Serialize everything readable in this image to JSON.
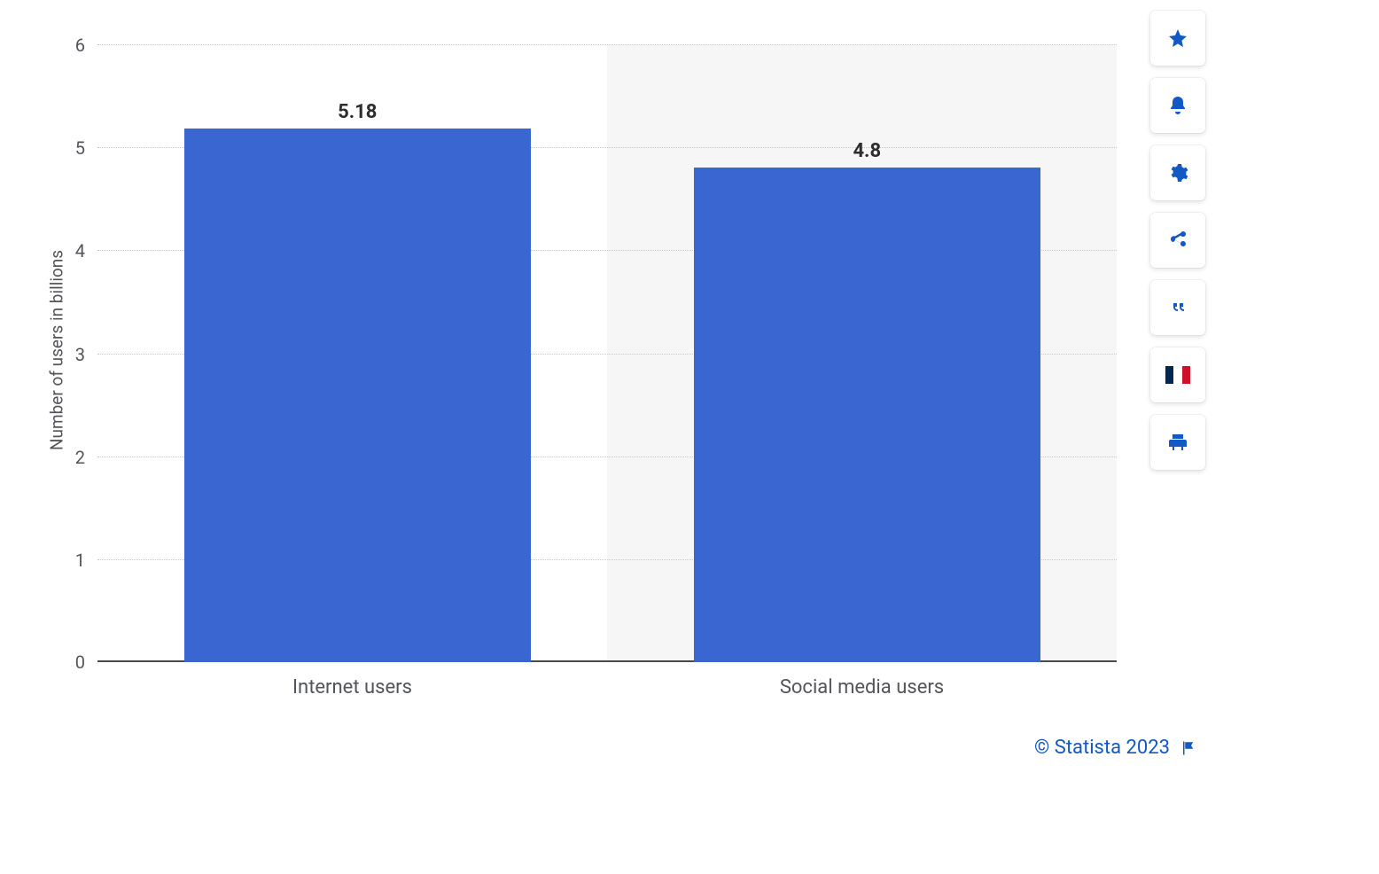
{
  "chart_data": {
    "type": "bar",
    "categories": [
      "Internet users",
      "Social media users"
    ],
    "values": [
      5.18,
      4.8
    ],
    "value_labels": [
      "5.18",
      "4.8"
    ],
    "ylabel": "Number of users in billions",
    "ylim": [
      0,
      6
    ],
    "yticks": [
      0,
      1,
      2,
      3,
      4,
      5,
      6
    ],
    "bar_color": "#3a66d2"
  },
  "footer": {
    "attribution": "© Statista 2023"
  },
  "sidebar": {
    "buttons": [
      {
        "name": "favorite",
        "icon": "star"
      },
      {
        "name": "notify",
        "icon": "bell"
      },
      {
        "name": "settings",
        "icon": "gear"
      },
      {
        "name": "share",
        "icon": "share"
      },
      {
        "name": "cite",
        "icon": "quote"
      },
      {
        "name": "language",
        "icon": "flag-fr"
      },
      {
        "name": "print",
        "icon": "print"
      }
    ]
  }
}
